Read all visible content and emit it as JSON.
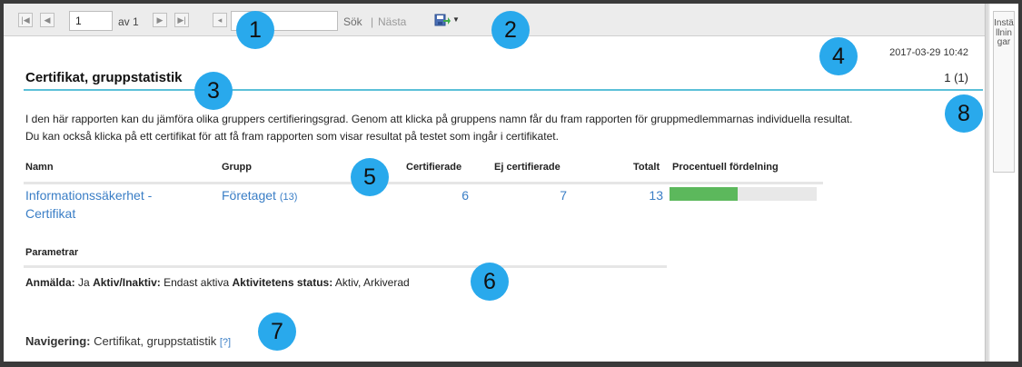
{
  "toolbar": {
    "first_page_icon": "first-page-icon",
    "prev_page_icon": "prev-page-icon",
    "page_value": "1",
    "of_label": "av 1",
    "next_page_icon": "next-page-icon",
    "last_page_icon": "last-page-icon",
    "back_icon": "back-icon",
    "search_value": "",
    "search_label": "Sök",
    "separator": "|",
    "next_label": "Nästa",
    "export_icon": "export-save-icon"
  },
  "side_panel": {
    "label": "Inställningar"
  },
  "report": {
    "timestamp": "2017-03-29 10:42",
    "title": "Certifikat, gruppstatistik",
    "page_count": "1 (1)",
    "description_line1": "I den här rapporten kan du jämföra olika gruppers certifieringsgrad. Genom att klicka på gruppens namn får du fram rapporten för gruppmedlemmarnas individuella resultat.",
    "description_line2": "Du kan också klicka på ett certifikat för att få fram rapporten som visar resultat på testet som ingår i certifikatet."
  },
  "table": {
    "headers": {
      "name": "Namn",
      "group": "Grupp",
      "certified": "Certifierade",
      "not_certified": "Ej certifierade",
      "total": "Totalt",
      "distribution": "Procentuell fördelning"
    },
    "rows": [
      {
        "name_line1": "Informationssäkerhet -",
        "name_line2": "Certifikat",
        "group": "Företaget",
        "group_count": "(13)",
        "certified": "6",
        "not_certified": "7",
        "total": "13",
        "certified_share": 0.4615
      }
    ]
  },
  "parameters": {
    "title": "Parametrar",
    "registered_label": "Anmälda:",
    "registered_value": "Ja",
    "active_label": "Aktiv/Inaktiv:",
    "active_value": "Endast aktiva",
    "status_label": "Aktivitetens status:",
    "status_value": "Aktiv, Arkiverad"
  },
  "navigation": {
    "label": "Navigering:",
    "value": "Certifikat, gruppstatistik",
    "help": "[?]"
  },
  "markers": [
    "1",
    "2",
    "3",
    "4",
    "5",
    "6",
    "7",
    "8"
  ],
  "colors": {
    "accent_rule": "#5bc0d8",
    "link": "#3a7ec6",
    "bar_fill": "#5cb85c",
    "marker": "#29a9ec"
  }
}
